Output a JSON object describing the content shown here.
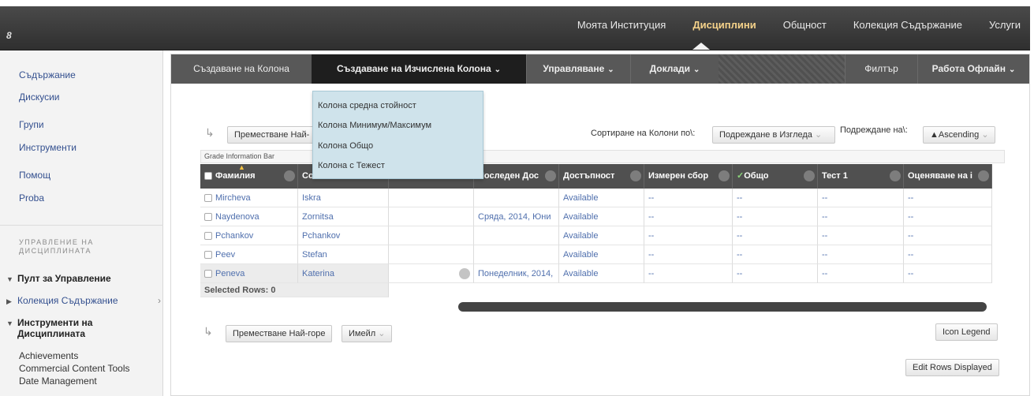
{
  "header": {
    "pin_label": "8",
    "nav": [
      "Моята Институция",
      "Дисциплини",
      "Общност",
      "Колекция Съдържание",
      "Услуги"
    ],
    "active_nav": "Дисциплини"
  },
  "sidebar": {
    "links": [
      "Съдържание",
      "Дискусии",
      "Групи",
      "Инструменти",
      "Помощ",
      "Proba"
    ],
    "section_heading_line1": "УПРАВЛЕНИЕ НА",
    "section_heading_line2": "ДИСЦИПЛИНАТА",
    "tree": [
      {
        "label": "Пулт за Управление",
        "state": "expanded"
      },
      {
        "label": "Колекция Съдържание",
        "state": "collapsed"
      },
      {
        "label": "Инструменти на",
        "label2": "Дисциплината",
        "state": "expanded"
      }
    ],
    "tools": [
      "Achievements",
      "Commercial Content Tools",
      "Date Management"
    ]
  },
  "actionbar": {
    "create_column": "Създаване на Колона",
    "create_calculated": "Създаване на Изчислена Колона",
    "manage": "Управляване",
    "reports": "Доклади",
    "filter": "Филтър",
    "work_offline": "Работа Офлайн"
  },
  "dropdown": [
    "Колона средна стойност",
    "Колона Минимум/Максимум",
    "Колона Общо",
    "Колона с Тежест"
  ],
  "toolbar": {
    "move_top": "Преместване Най-горе",
    "move_top_partial": "Преместване Най-",
    "sort_columns_label": "Сортиране на Колони по\\:",
    "sort_select": "Подреждане в Изгледа",
    "order_label": "Подреждане на\\:",
    "order_select": "▲Ascending",
    "email": "Имейл",
    "grade_info_bar": "Grade Information Bar",
    "selected_rows": "Selected Rows: 0",
    "icon_legend": "Icon Legend",
    "edit_rows": "Edit Rows Displayed"
  },
  "grid": {
    "headers": [
      "Фамилия",
      "Со",
      "",
      "Последен Дос",
      "Достъпност",
      "Измерен сбор",
      "Общо",
      "Тест 1",
      "Оценяване на і"
    ],
    "rows": [
      [
        "Mircheva",
        "Iskra",
        "",
        "",
        "Available",
        "--",
        "--",
        "--",
        "--"
      ],
      [
        "Naydenova",
        "Zornitsa",
        "",
        "Сряда, 2014, Юни",
        "Available",
        "--",
        "--",
        "--",
        "--"
      ],
      [
        "Pchankov",
        "Pchankov",
        "",
        "",
        "Available",
        "--",
        "--",
        "--",
        "--"
      ],
      [
        "Peev",
        "Stefan",
        "",
        "",
        "Available",
        "--",
        "--",
        "--",
        "--"
      ],
      [
        "Peneva",
        "Katerina",
        "",
        "Понеделник, 2014,",
        "Available",
        "--",
        "--",
        "--",
        "--"
      ]
    ]
  }
}
